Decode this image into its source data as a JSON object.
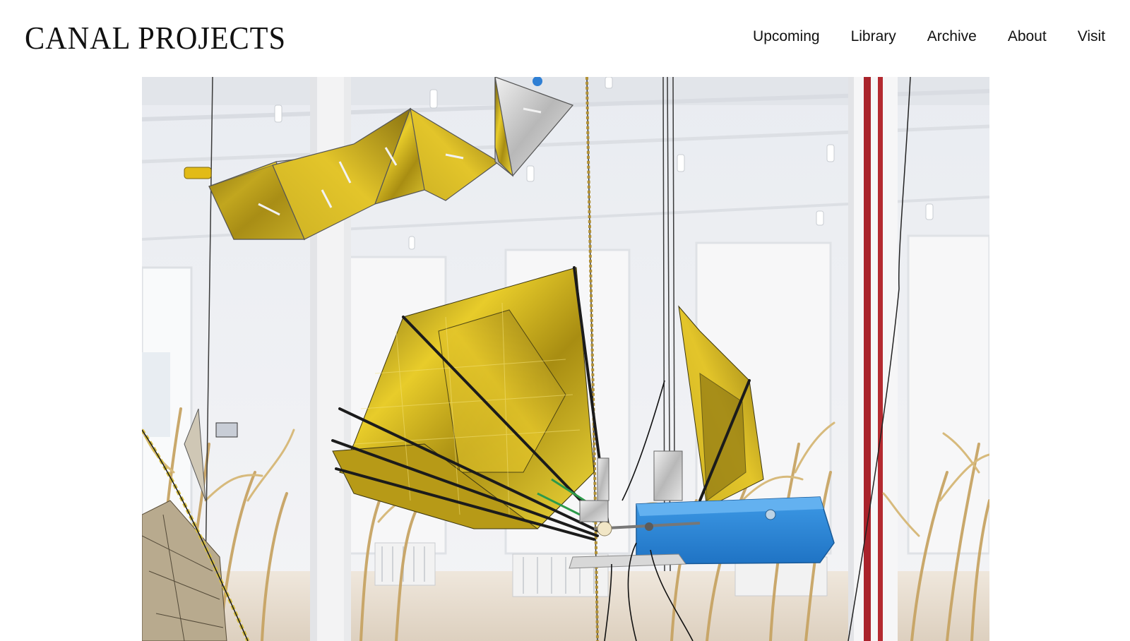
{
  "header": {
    "logo_text": "CANAL PROJECTS",
    "nav": [
      {
        "label": "Upcoming"
      },
      {
        "label": "Library"
      },
      {
        "label": "Archive"
      },
      {
        "label": "About"
      },
      {
        "label": "Visit"
      }
    ]
  },
  "hero": {
    "subject": "installation-photo",
    "colors": {
      "wall": "#f1f2f5",
      "floor": "#e6ddd2",
      "gold": "#d4b21a",
      "blue": "#2f8bd8",
      "corn": "#c9a96b",
      "pipe": "#b0222a"
    }
  }
}
